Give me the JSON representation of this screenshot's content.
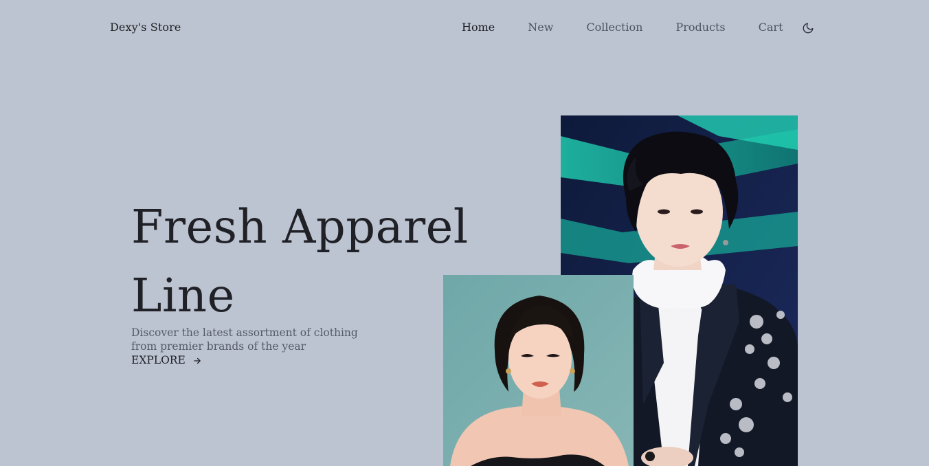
{
  "header": {
    "brand": "Dexy's Store",
    "nav": [
      {
        "label": "Home",
        "active": true
      },
      {
        "label": "New",
        "active": false
      },
      {
        "label": "Collection",
        "active": false
      },
      {
        "label": "Products",
        "active": false
      },
      {
        "label": "Cart",
        "active": false
      }
    ],
    "theme_toggle_icon": "moon-icon"
  },
  "hero": {
    "title_line1": "Fresh Apparel",
    "title_line2": "Line",
    "description": "Discover the latest assortment of clothing from premier brands of the year",
    "cta_label": "EXPLORE",
    "cta_icon": "arrow-right-icon"
  },
  "images": {
    "primary": "male-model-photo",
    "secondary": "female-model-photo"
  },
  "colors": {
    "background": "#bcc3d1",
    "text": "#1f1f24",
    "muted": "#555b68"
  }
}
